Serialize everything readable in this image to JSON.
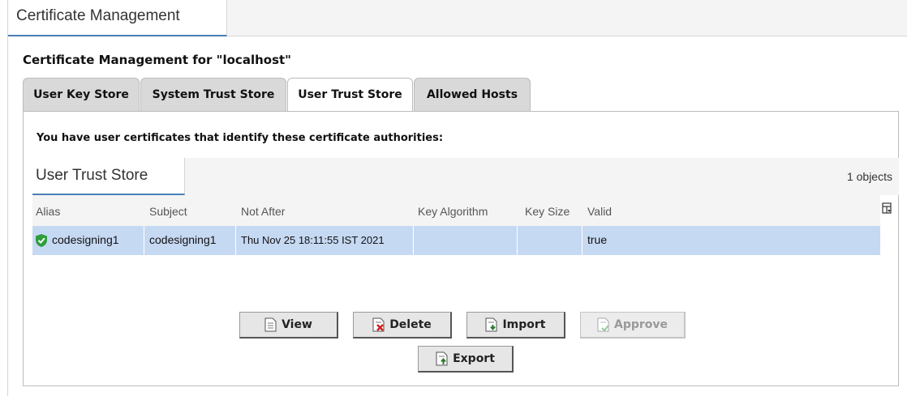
{
  "window": {
    "tab_label": "Certificate Management"
  },
  "panel": {
    "title": "Certificate Management for \"localhost\""
  },
  "tabs": [
    {
      "label": "User Key Store"
    },
    {
      "label": "System Trust Store"
    },
    {
      "label": "User Trust Store"
    },
    {
      "label": "Allowed Hosts"
    }
  ],
  "content": {
    "intro": "You have user certificates that identify these certificate authorities:",
    "table_title": "User Trust Store",
    "object_count": "1 objects",
    "columns": [
      "Alias",
      "Subject",
      "Not After",
      "Key Algorithm",
      "Key Size",
      "Valid"
    ],
    "rows": [
      {
        "alias": "codesigning1",
        "subject": "codesigning1",
        "not_after": "Thu Nov 25 18:11:55 IST 2021",
        "key_algorithm": "",
        "key_size": "",
        "valid": "true",
        "status_icon": "green-check-shield-icon"
      }
    ]
  },
  "buttons": {
    "view": "View",
    "delete": "Delete",
    "import": "Import",
    "approve": "Approve",
    "export": "Export"
  },
  "colors": {
    "selected_row": "#c6d9f3",
    "accent_underline": "#4a7fb6",
    "shield_green": "#2e9e3a"
  }
}
